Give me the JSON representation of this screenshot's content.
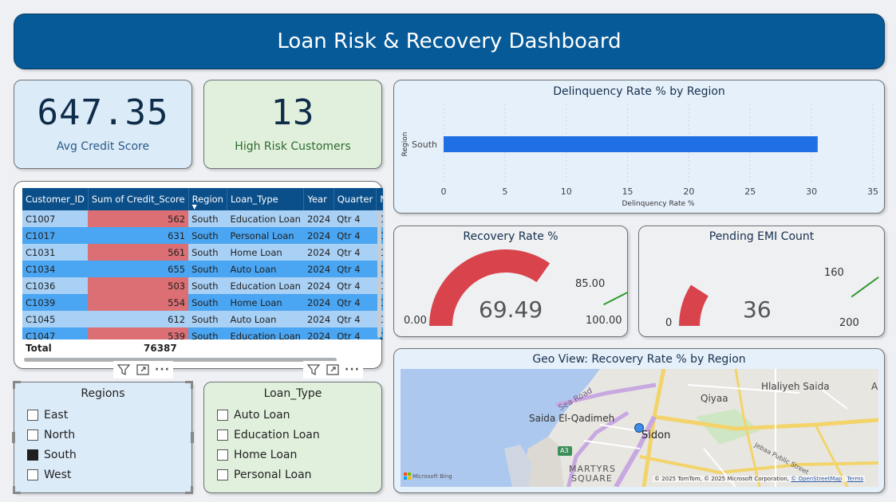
{
  "header": {
    "title": "Loan Risk & Recovery Dashboard"
  },
  "kpis": [
    {
      "value": "647.35",
      "label": "Avg Credit Score",
      "label_color": "#2a5a8a"
    },
    {
      "value": "13",
      "label": "High Risk Customers",
      "label_color": "#2e6b2e"
    }
  ],
  "table": {
    "columns": [
      "Customer_ID",
      "Sum of Credit_Score",
      "Region",
      "Loan_Type",
      "Year",
      "Quarter",
      "Mon"
    ],
    "rows": [
      {
        "id": "C1007",
        "score": "562",
        "region": "South",
        "loan": "Education Loan",
        "year": "2024",
        "quarter": "Qtr 4",
        "month": "Dece",
        "risk": true
      },
      {
        "id": "C1017",
        "score": "631",
        "region": "South",
        "loan": "Personal Loan",
        "year": "2024",
        "quarter": "Qtr 4",
        "month": "Dece",
        "risk": false
      },
      {
        "id": "C1031",
        "score": "561",
        "region": "South",
        "loan": "Home Loan",
        "year": "2024",
        "quarter": "Qtr 4",
        "month": "Dece",
        "risk": true
      },
      {
        "id": "C1034",
        "score": "655",
        "region": "South",
        "loan": "Auto Loan",
        "year": "2024",
        "quarter": "Qtr 4",
        "month": "Dece",
        "risk": false
      },
      {
        "id": "C1036",
        "score": "503",
        "region": "South",
        "loan": "Education Loan",
        "year": "2024",
        "quarter": "Qtr 4",
        "month": "Dece",
        "risk": true
      },
      {
        "id": "C1039",
        "score": "554",
        "region": "South",
        "loan": "Home Loan",
        "year": "2024",
        "quarter": "Qtr 4",
        "month": "Dece",
        "risk": true
      },
      {
        "id": "C1045",
        "score": "612",
        "region": "South",
        "loan": "Auto Loan",
        "year": "2024",
        "quarter": "Qtr 4",
        "month": "Dece",
        "risk": false
      },
      {
        "id": "C1047",
        "score": "539",
        "region": "South",
        "loan": "Education Loan",
        "year": "2024",
        "quarter": "Qtr 4",
        "month": "Dece",
        "risk": true
      }
    ],
    "total_label": "Total",
    "total_value": "76387"
  },
  "slicer_regions": {
    "title": "Regions",
    "items": [
      {
        "label": "East",
        "checked": false
      },
      {
        "label": "North",
        "checked": false
      },
      {
        "label": "South",
        "checked": true
      },
      {
        "label": "West",
        "checked": false
      }
    ]
  },
  "slicer_loan": {
    "title": "Loan_Type",
    "items": [
      {
        "label": "Auto Loan",
        "checked": false
      },
      {
        "label": "Education Loan",
        "checked": false
      },
      {
        "label": "Home Loan",
        "checked": false
      },
      {
        "label": "Personal Loan",
        "checked": false
      }
    ]
  },
  "delinquency": {
    "title": "Delinquency Rate % by Region",
    "chart_data": {
      "type": "bar",
      "orientation": "horizontal",
      "categories": [
        "South"
      ],
      "values": [
        30.5
      ],
      "xlabel": "Delinquency Rate %",
      "ylabel": "Region",
      "xlim": [
        0,
        35
      ],
      "xticks": [
        "0",
        "5",
        "10",
        "15",
        "20",
        "25",
        "30",
        "35"
      ],
      "grid": true,
      "bar_color": "#1f6fe5"
    }
  },
  "recovery": {
    "title": "Recovery Rate %",
    "value": "69.49",
    "min": "0.00",
    "max": "100.00",
    "target": "85.00",
    "fraction": 0.6949,
    "target_fraction": 0.85,
    "fill_color": "#d9444c"
  },
  "pending": {
    "title": "Pending EMI Count",
    "value": "36",
    "min": "0",
    "max": "200",
    "target": "160",
    "fraction": 0.18,
    "target_fraction": 0.8,
    "fill_color": "#d9444c"
  },
  "map": {
    "title": "Geo View: Recovery Rate % by Region",
    "labels": {
      "qiyaa": "Qiyaa",
      "hlaliyeh": "Hlaliyeh Saida",
      "saida": "Saida El-Qadimeh",
      "sidon": "Sidon",
      "martyrs1": "MARTYRS",
      "martyrs2": "SQUARE",
      "searoad": "Sea Road",
      "a3": "A3",
      "jebaa": "Jebaa Public Street",
      "a_edge": "A"
    },
    "brand": "Microsoft Bing",
    "attribution": "© 2025 TomTom, © 2025 Microsoft Corporation,",
    "osm": "© OpenStreetMap",
    "terms": "Terms"
  },
  "toolbar": {
    "more": "···"
  }
}
